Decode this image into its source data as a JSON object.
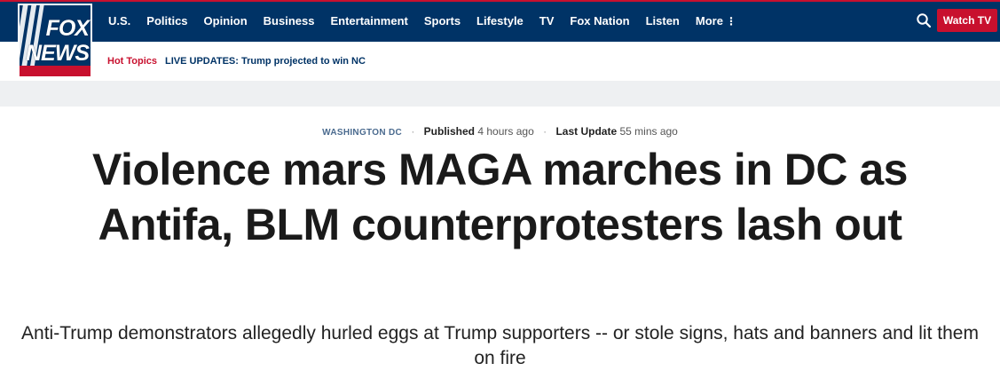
{
  "logo": {
    "word1": "FOX",
    "word2": "NEWS"
  },
  "nav": {
    "items": [
      "U.S.",
      "Politics",
      "Opinion",
      "Business",
      "Entertainment",
      "Sports",
      "Lifestyle",
      "TV",
      "Fox Nation",
      "Listen"
    ],
    "more_label": "More",
    "watch_tv_label": "Watch TV"
  },
  "subnav": {
    "hot_topics_label": "Hot Topics",
    "live_update_text": "LIVE UPDATES: Trump projected to win NC"
  },
  "article": {
    "location": "WASHINGTON DC",
    "published_label": "Published",
    "published_value": "4 hours ago",
    "updated_label": "Last Update",
    "updated_value": "55 mins ago",
    "headline": "Violence mars MAGA marches in DC as Antifa, BLM counterprotesters lash out",
    "subheadline": "Anti-Trump demonstrators allegedly hurled eggs at Trump supporters -- or stole signs, hats and banners and lit them on fire"
  },
  "colors": {
    "navy": "#003366",
    "red": "#c8102e",
    "gray_band": "#eef0f2"
  },
  "icons": {
    "search": "search-icon",
    "more": "kebab-icon"
  }
}
